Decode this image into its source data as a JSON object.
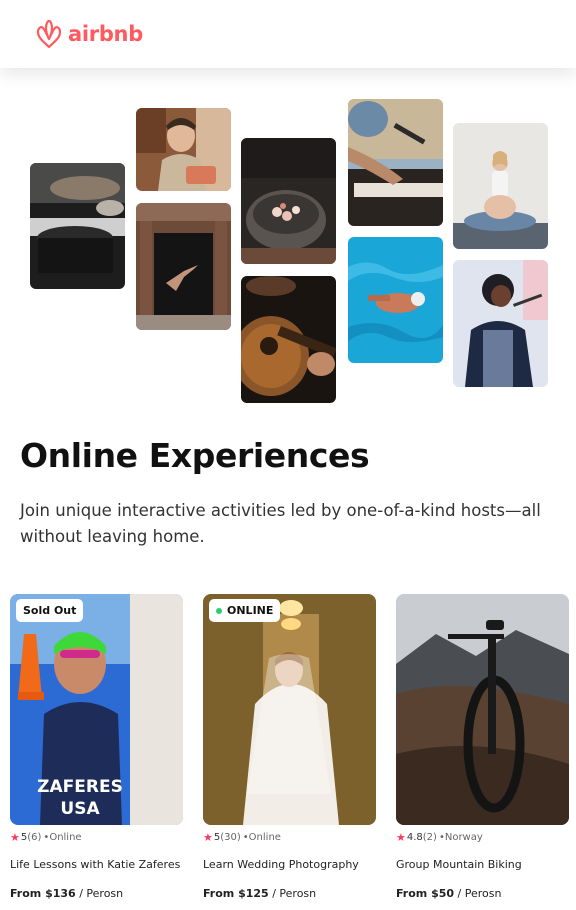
{
  "header": {
    "logo_text": "airbnb",
    "brand_color": "#FF5A5F"
  },
  "collage": {
    "tiles": [
      {
        "name": "cooking-photo"
      },
      {
        "name": "potter-photo"
      },
      {
        "name": "dancer-photo"
      },
      {
        "name": "food-bowl-photo"
      },
      {
        "name": "guitar-photo"
      },
      {
        "name": "music-keyboard-photo"
      },
      {
        "name": "swimmer-photo"
      },
      {
        "name": "yoga-photo"
      },
      {
        "name": "singer-photo"
      }
    ]
  },
  "hero": {
    "title": "Online Experiences",
    "subtitle": "Join unique interactive activities led by one-of-a-kind hosts—all without leaving home."
  },
  "cards": [
    {
      "badge": "Sold Out",
      "rating": "5",
      "reviews": "(6)",
      "location": "•Online",
      "title": "Life Lessons with Katie Zaferes",
      "price": "From $136",
      "unit": "/ Perosn"
    },
    {
      "badge": "ONLINE",
      "rating": "5",
      "reviews": "(30)",
      "location": "•Online",
      "title": "Learn Wedding Photography",
      "price": "From $125",
      "unit": "/ Perosn"
    },
    {
      "badge": "",
      "rating": "4.8",
      "reviews": "(2)",
      "location": "•Norway",
      "title": "Group Mountain Biking",
      "price": "From $50",
      "unit": "/ Perosn"
    }
  ],
  "card_image_text": {
    "swimsuit_line1": "ZAFERES",
    "swimsuit_line2": "USA"
  },
  "colors": {
    "star": "#FF385C",
    "online_dot": "#2ecc71"
  },
  "icons": {
    "logo": "airbnb-belo-icon",
    "star": "star-icon",
    "status": "online-dot-icon"
  }
}
